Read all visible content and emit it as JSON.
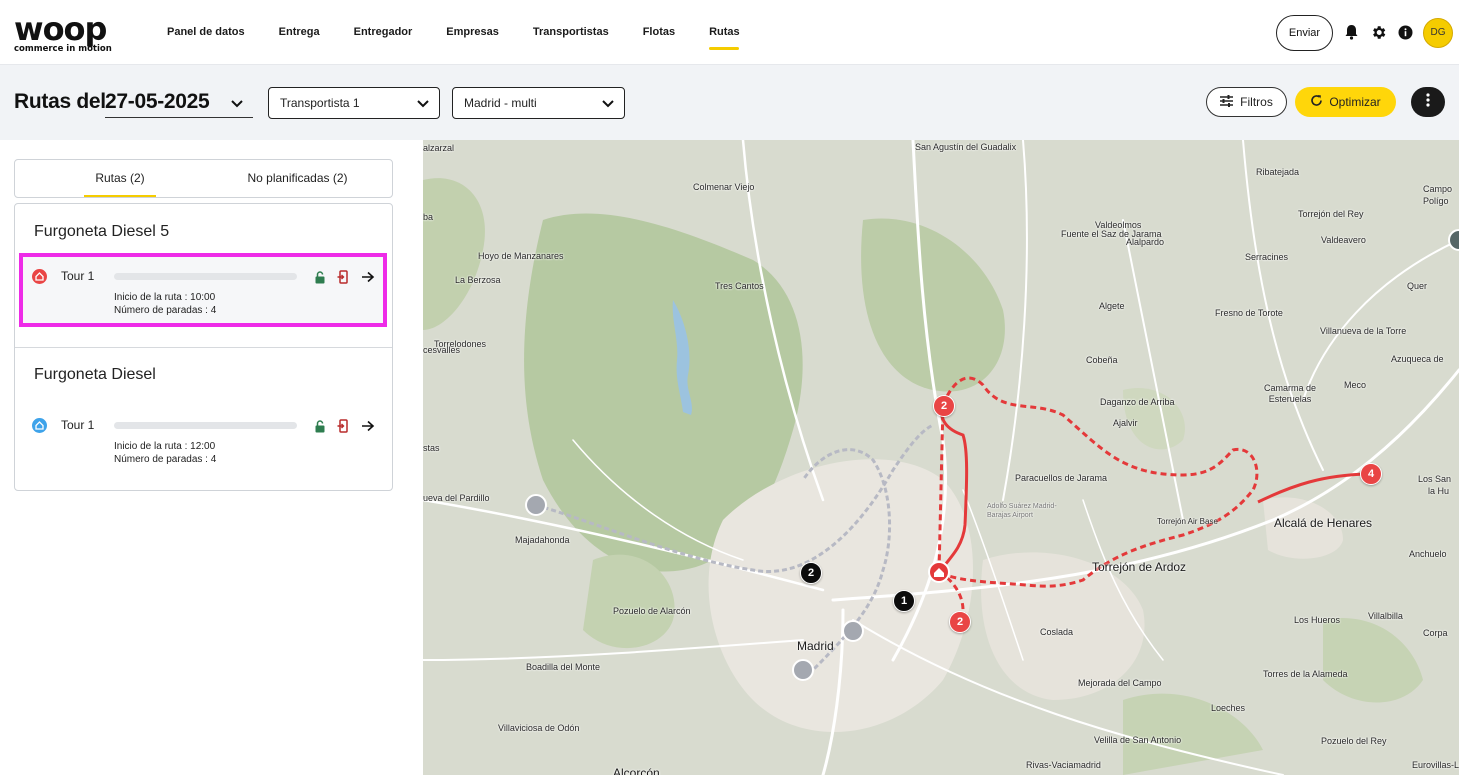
{
  "brand": {
    "name": "woop",
    "tagline": "commerce in motion"
  },
  "nav": {
    "items": [
      "Panel de datos",
      "Entrega",
      "Entregador",
      "Empresas",
      "Transportistas",
      "Flotas",
      "Rutas"
    ],
    "active": "Rutas",
    "send_label": "Enviar",
    "avatar_initials": "DG",
    "icons": [
      "bell-icon",
      "gear-icon",
      "info-icon"
    ]
  },
  "toolbar": {
    "title_prefix": "Rutas del",
    "date": "27-05-2025",
    "carrier": "Transportista 1",
    "zone": "Madrid - multi",
    "filters_label": "Filtros",
    "optimize_label": "Optimizar"
  },
  "tabs": [
    {
      "label": "Rutas (2)",
      "active": true
    },
    {
      "label": "No planificadas (2)",
      "active": false
    }
  ],
  "vehicles": [
    {
      "name": "Furgoneta Diesel 5",
      "tours": [
        {
          "name": "Tour 1",
          "start": "Inicio de la ruta : 10:00",
          "stops": "Número de paradas : 4",
          "progress": 0,
          "color": "#e94545",
          "selected": true
        }
      ]
    },
    {
      "name": "Furgoneta Diesel",
      "tours": [
        {
          "name": "Tour 1",
          "start": "Inicio de la ruta : 12:00",
          "stops": "Número de paradas : 4",
          "progress": 0,
          "color": "#3ea3ea",
          "selected": false
        }
      ]
    }
  ],
  "map": {
    "places": [
      "San Agustín del Guadalix",
      "Colmenar Viejo",
      "Ribatejada",
      "Torrejón del Rey",
      "Fuente el Saz de Jarama",
      "Valdeolmos",
      "Alalpardo",
      "Valdeavero",
      "Hoyo de Manzanares",
      "Serracines",
      "La Berzosa",
      "Tres Cantos",
      "Quer",
      "Algete",
      "Fresno de Torote",
      "Villanueva de la Torre",
      "Torrelodones",
      "Cobeña",
      "Azuqueca de",
      "Camarma de Esteruelas",
      "Meco",
      "Daganzo de Arriba",
      "Ajalvir",
      "Paracuellos de Jarama",
      "Los San",
      "la Hu",
      "Torrejón Air Base",
      "Alcalá de Henares",
      "Adolfo Suárez Madrid-Barajas Airport",
      "Majadahonda",
      "Torrejón de Ardoz",
      "Anchuelo",
      "Pozuelo de Alarcón",
      "Los Hueros",
      "Villalbilla",
      "Madrid",
      "Coslada",
      "Boadilla del Monte",
      "Mejorada del Campo",
      "Torres de la Alameda",
      "Loeches",
      "Velilla de San Antonio",
      "Pozuelo del Rey",
      "Villaviciosa de Odón",
      "Rivas-Vaciamadrid",
      "Eurovillas-Lo",
      "Alcorcón",
      "alzarzal",
      "ba",
      "cesvalles",
      "stas",
      "ueva del Pardillo",
      "Campo",
      "Polígo",
      "Corpa"
    ],
    "markers": [
      {
        "label": "2",
        "color": "red"
      },
      {
        "label": "2",
        "color": "red"
      },
      {
        "label": "4",
        "color": "red"
      },
      {
        "label": "2",
        "color": "black"
      },
      {
        "label": "1",
        "color": "black"
      }
    ]
  }
}
